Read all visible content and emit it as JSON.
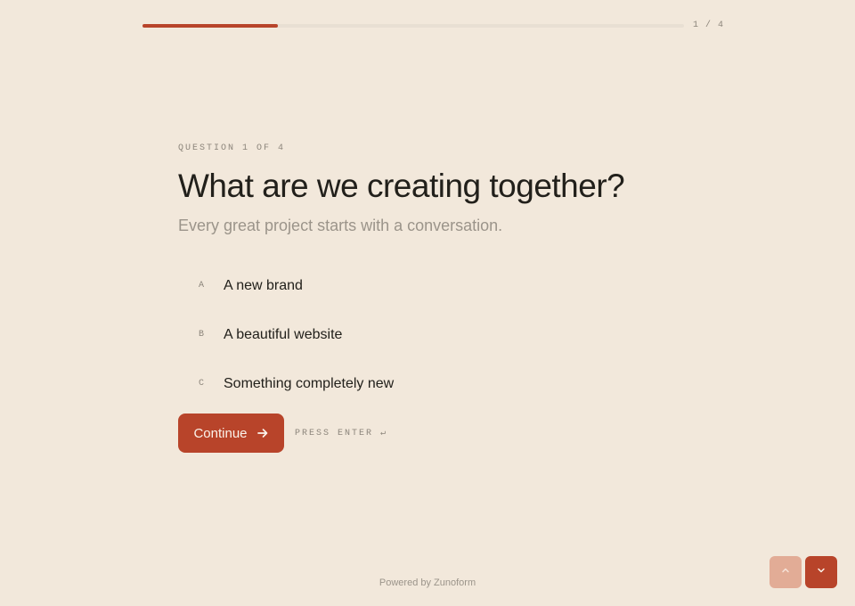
{
  "progress": {
    "fraction": 0.25,
    "count_label": "1 / 4"
  },
  "question": {
    "eyebrow": "QUESTION 1 OF 4",
    "title": "What are we creating together?",
    "subtitle": "Every great project starts with a conversation."
  },
  "options": [
    {
      "key": "A",
      "label": "A new brand"
    },
    {
      "key": "B",
      "label": "A beautiful website"
    },
    {
      "key": "C",
      "label": "Something completely new"
    }
  ],
  "actions": {
    "continue_label": "Continue",
    "press_hint": "PRESS ENTER ↵"
  },
  "footer": {
    "powered_by": "Powered by Zunoform"
  },
  "nav": {
    "up_icon": "chevron-up-icon",
    "down_icon": "chevron-down-icon"
  },
  "colors": {
    "background": "#f2e8db",
    "accent": "#b8442a",
    "accent_light": "#e2ac96"
  }
}
